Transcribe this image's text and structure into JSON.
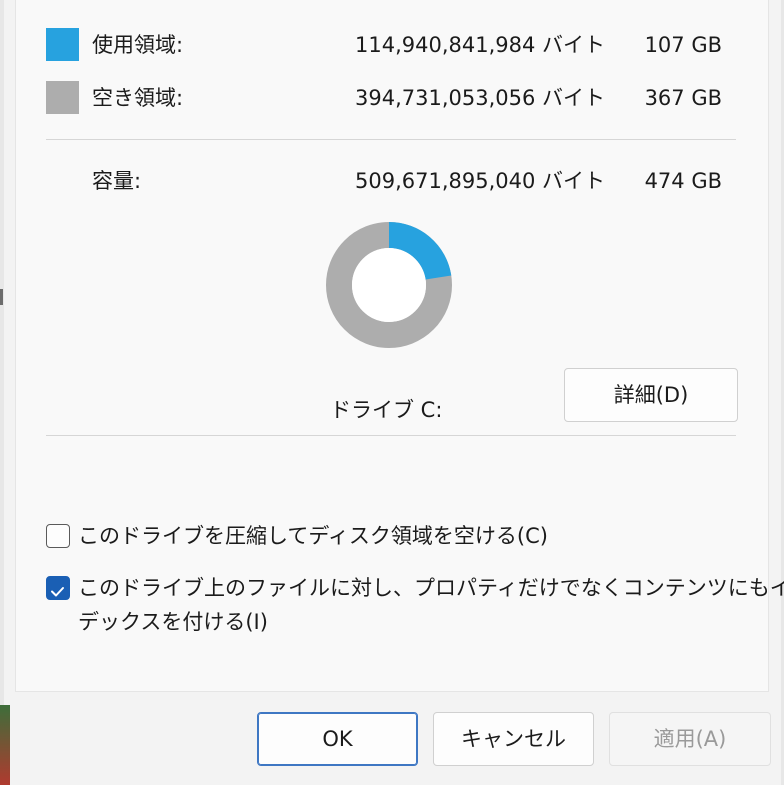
{
  "colors": {
    "used": "#27a2df",
    "free": "#adadad",
    "accent": "#1a5fb4"
  },
  "usage": {
    "used": {
      "label": "使用領域:",
      "bytes": "114,940,841,984 バイト",
      "gb": "107 GB"
    },
    "free": {
      "label": "空き領域:",
      "bytes": "394,731,053,056 バイト",
      "gb": "367 GB"
    },
    "capacity": {
      "label": "容量:",
      "bytes": "509,671,895,040 バイト",
      "gb": "474 GB"
    }
  },
  "donut": {
    "used_fraction": 0.2255
  },
  "drive": {
    "label": "ドライブ C:"
  },
  "details_button": {
    "label": "詳細(D)"
  },
  "options": {
    "compress": {
      "label": "このドライブを圧縮してディスク領域を空ける(C)",
      "checked": false
    },
    "index": {
      "label_line1": "このドライブ上のファイルに対し、プロパティだけでなくコンテンツにもイン",
      "label_line2": "デックスを付ける(I)",
      "checked": true
    }
  },
  "footer": {
    "ok_label": "OK",
    "cancel_label": "キャンセル",
    "apply_label": "適用(A)"
  }
}
